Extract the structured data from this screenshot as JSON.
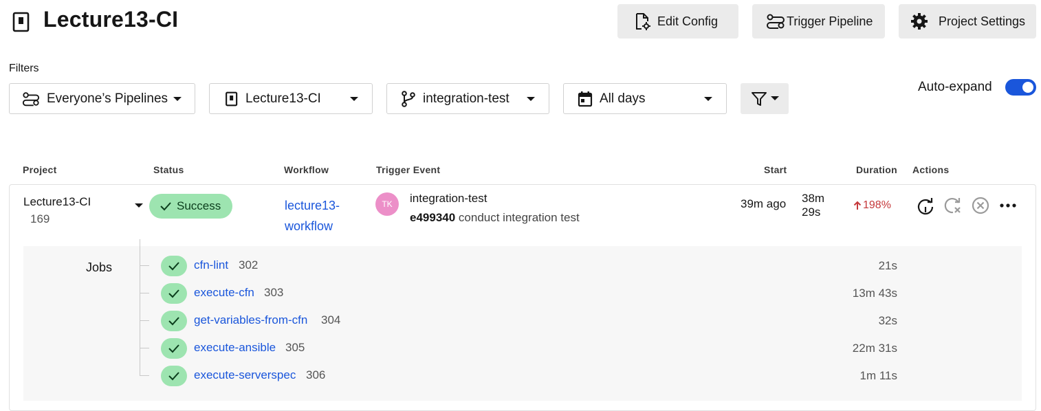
{
  "header": {
    "title": "Lecture13-CI",
    "edit_config": "Edit Config",
    "trigger_pipeline": "Trigger Pipeline",
    "project_settings": "Project Settings"
  },
  "filters": {
    "label": "Filters",
    "pipelines": "Everyone’s Pipelines",
    "project": "Lecture13-CI",
    "branch": "integration-test",
    "days": "All days",
    "auto_expand_label": "Auto-expand",
    "auto_expand_on": true
  },
  "table": {
    "columns": {
      "project": "Project",
      "status": "Status",
      "workflow": "Workflow",
      "trigger": "Trigger Event",
      "start": "Start",
      "duration": "Duration",
      "actions": "Actions"
    },
    "row": {
      "project": "Lecture13-CI",
      "number": "169",
      "status": "Success",
      "workflow": "lecture13-workflow",
      "avatar_initials": "TK",
      "trigger_branch": "integration-test",
      "commit_sha": "e499340",
      "commit_message": "conduct integration test",
      "start": "39m ago",
      "duration_min": "38m",
      "duration_sec": "29s",
      "duration_change": "198%"
    }
  },
  "jobs": {
    "label": "Jobs",
    "items": [
      {
        "name": "cfn-lint",
        "number": "302",
        "duration": "21s"
      },
      {
        "name": "execute-cfn",
        "number": "303",
        "duration": "13m 43s"
      },
      {
        "name": "get-variables-from-cfn",
        "number": "304",
        "duration": "32s"
      },
      {
        "name": "execute-ansible",
        "number": "305",
        "duration": "22m 31s"
      },
      {
        "name": "execute-serverspec",
        "number": "306",
        "duration": "1m 11s"
      }
    ]
  },
  "colors": {
    "accent": "#1a56db",
    "success": "#9de4b0",
    "avatar": "#ec8fc8",
    "increase": "#c5383a"
  }
}
